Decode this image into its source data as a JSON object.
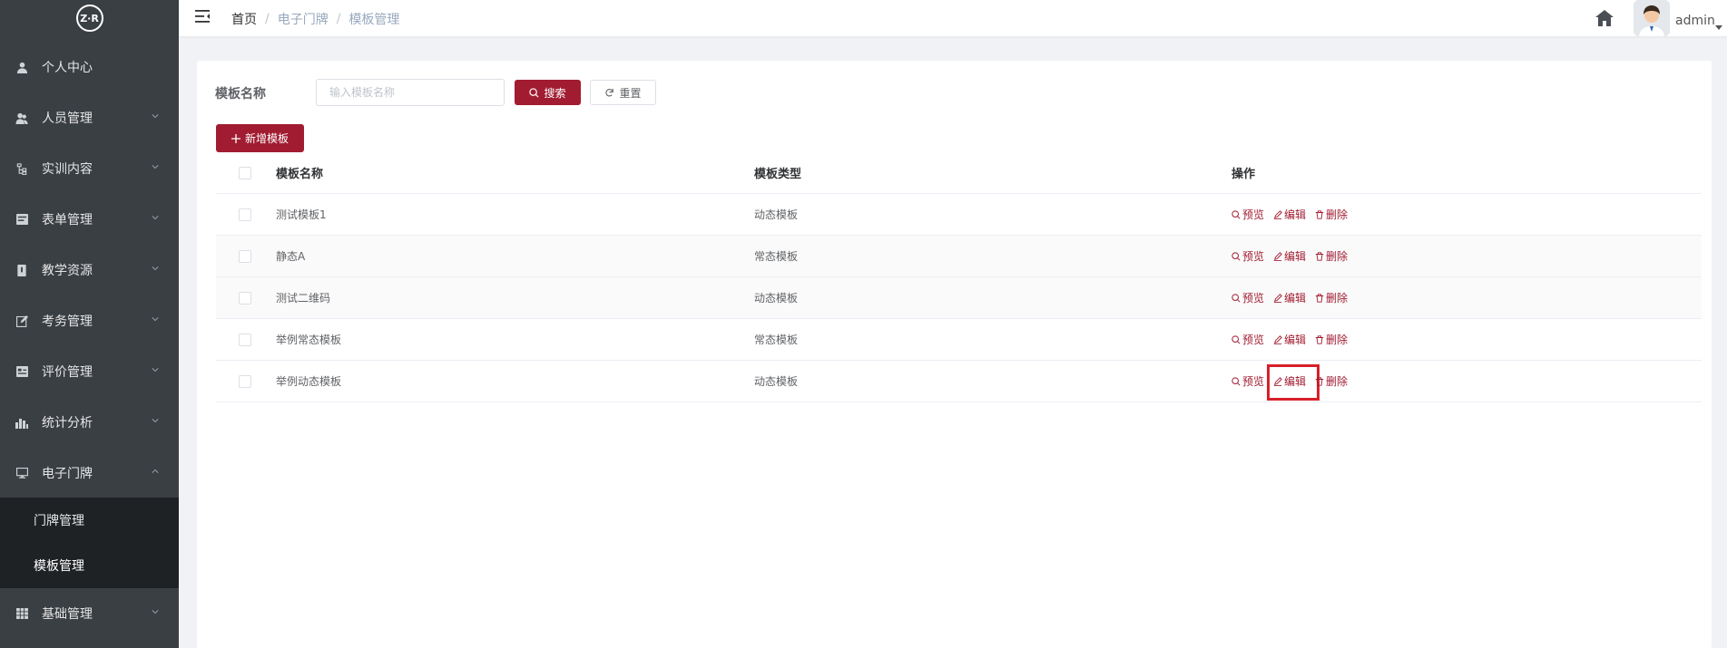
{
  "brand": {
    "logo_text": "Z·R"
  },
  "sidebar": {
    "items": [
      {
        "label": "个人中心",
        "icon": "user-icon"
      },
      {
        "label": "人员管理",
        "icon": "users-icon"
      },
      {
        "label": "实训内容",
        "icon": "tree-icon"
      },
      {
        "label": "表单管理",
        "icon": "form-icon"
      },
      {
        "label": "教学资源",
        "icon": "book-icon"
      },
      {
        "label": "考务管理",
        "icon": "edit-icon"
      },
      {
        "label": "评价管理",
        "icon": "rating-icon"
      },
      {
        "label": "统计分析",
        "icon": "chart-icon"
      },
      {
        "label": "电子门牌",
        "icon": "monitor-icon"
      },
      {
        "label": "基础管理",
        "icon": "grid-icon"
      }
    ],
    "submenu": [
      {
        "label": "门牌管理"
      },
      {
        "label": "模板管理"
      }
    ]
  },
  "header": {
    "breadcrumb": [
      "首页",
      "电子门牌",
      "模板管理"
    ],
    "username": "admin"
  },
  "search": {
    "label": "模板名称",
    "placeholder": "输入模板名称",
    "search_label": "搜索",
    "reset_label": "重置"
  },
  "toolbar": {
    "add_label": "新增模板"
  },
  "table": {
    "headers": [
      "模板名称",
      "模板类型",
      "操作"
    ],
    "rows": [
      {
        "name": "测试模板1",
        "type": "动态模板"
      },
      {
        "name": "静态A",
        "type": "常态模板"
      },
      {
        "name": "测试二维码",
        "type": "动态模板"
      },
      {
        "name": "举例常态模板",
        "type": "常态模板"
      },
      {
        "name": "举例动态模板",
        "type": "动态模板"
      }
    ],
    "actions": {
      "preview": "预览",
      "edit": "编辑",
      "delete": "删除"
    }
  },
  "colors": {
    "primary": "#a11c31",
    "sidebar": "#3a3f44",
    "submenu": "#1f2225",
    "highlight": "#d8202a"
  }
}
